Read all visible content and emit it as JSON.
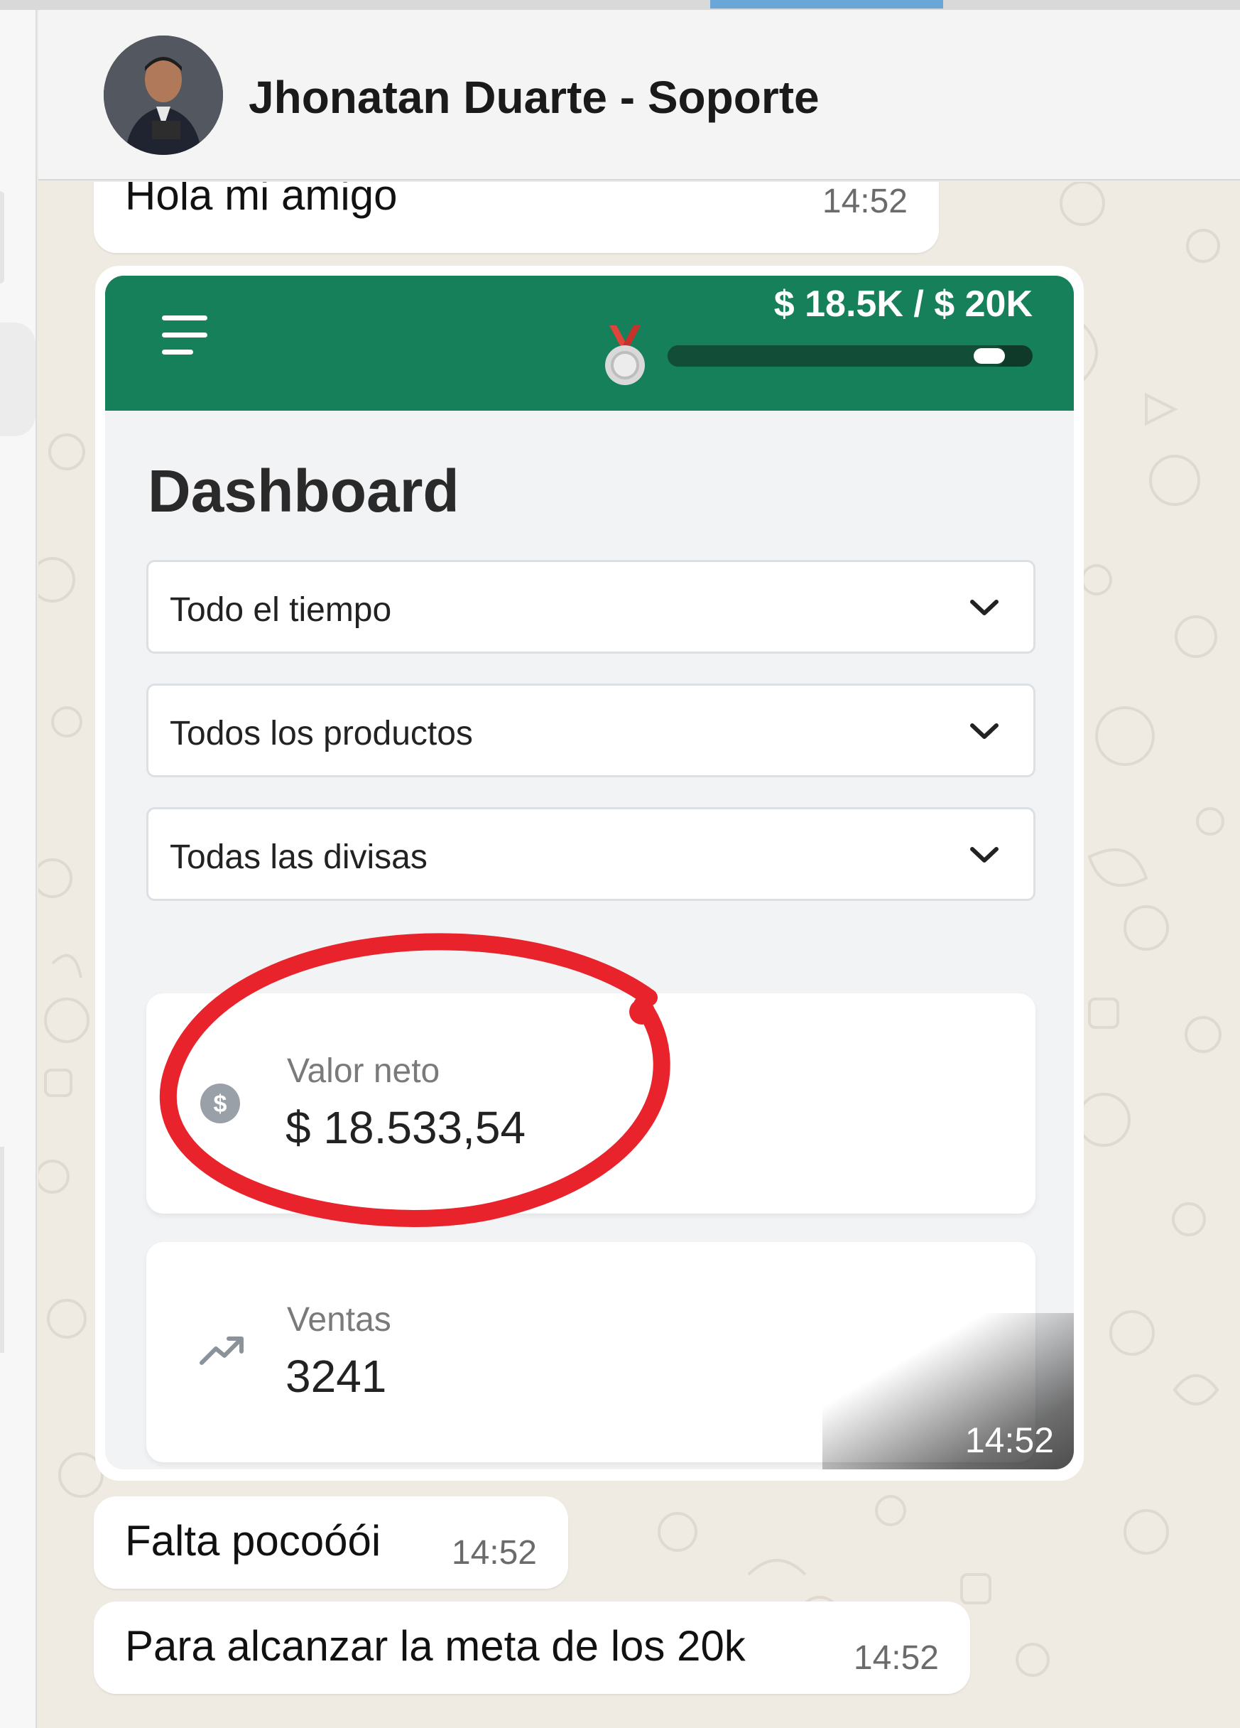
{
  "header": {
    "contact_name": "Jhonatan Duarte - Soporte"
  },
  "messages": [
    {
      "text": "Hola mi amigo",
      "time": "14:52"
    },
    {
      "text": "Falta pocoóói",
      "time": "14:52"
    },
    {
      "text": "Para alcanzar la meta de los 20k",
      "time": "14:52"
    }
  ],
  "image_message": {
    "time": "14:52",
    "app": {
      "goal_text": "$ 18.5K / $ 20K",
      "goal_progress": 0.925,
      "title": "Dashboard",
      "filters": [
        {
          "label": "Todo el tiempo"
        },
        {
          "label": "Todos los productos"
        },
        {
          "label": "Todas las divisas"
        }
      ],
      "cards": [
        {
          "label": "Valor neto",
          "value": "$ 18.533,54",
          "icon": "dollar-circle-icon"
        },
        {
          "label": "Ventas",
          "value": "3241",
          "icon": "trending-up-icon"
        }
      ]
    }
  },
  "colors": {
    "app_header": "#16805a",
    "highlight_ring": "#e8232b",
    "chat_background": "#efeae2"
  }
}
